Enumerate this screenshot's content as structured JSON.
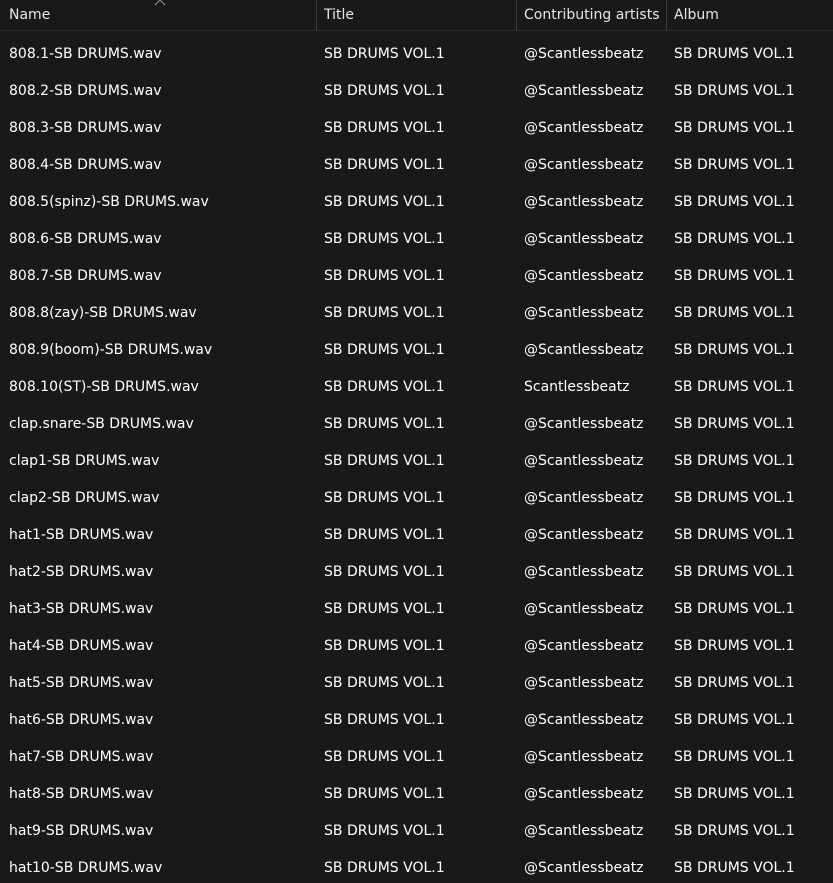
{
  "columns": {
    "name": "Name",
    "title": "Title",
    "artist": "Contributing artists",
    "album": "Album"
  },
  "sort": {
    "icon": "chevron-up-icon",
    "column": "Name"
  },
  "files": [
    {
      "name": "808.1-SB DRUMS.wav",
      "title": "SB DRUMS VOL.1",
      "artist": "@Scantlessbeatz",
      "album": "SB DRUMS VOL.1"
    },
    {
      "name": "808.2-SB DRUMS.wav",
      "title": "SB DRUMS VOL.1",
      "artist": "@Scantlessbeatz",
      "album": "SB DRUMS VOL.1"
    },
    {
      "name": "808.3-SB DRUMS.wav",
      "title": "SB DRUMS VOL.1",
      "artist": "@Scantlessbeatz",
      "album": "SB DRUMS VOL.1"
    },
    {
      "name": "808.4-SB DRUMS.wav",
      "title": "SB DRUMS VOL.1",
      "artist": "@Scantlessbeatz",
      "album": "SB DRUMS VOL.1"
    },
    {
      "name": "808.5(spinz)-SB DRUMS.wav",
      "title": "SB DRUMS VOL.1",
      "artist": "@Scantlessbeatz",
      "album": "SB DRUMS VOL.1"
    },
    {
      "name": "808.6-SB DRUMS.wav",
      "title": "SB DRUMS VOL.1",
      "artist": "@Scantlessbeatz",
      "album": "SB DRUMS VOL.1"
    },
    {
      "name": "808.7-SB DRUMS.wav",
      "title": "SB DRUMS VOL.1",
      "artist": "@Scantlessbeatz",
      "album": "SB DRUMS VOL.1"
    },
    {
      "name": "808.8(zay)-SB DRUMS.wav",
      "title": "SB DRUMS VOL.1",
      "artist": "@Scantlessbeatz",
      "album": "SB DRUMS VOL.1"
    },
    {
      "name": "808.9(boom)-SB DRUMS.wav",
      "title": "SB DRUMS VOL.1",
      "artist": "@Scantlessbeatz",
      "album": "SB DRUMS VOL.1"
    },
    {
      "name": "808.10(ST)-SB DRUMS.wav",
      "title": "SB DRUMS VOL.1",
      "artist": "Scantlessbeatz",
      "album": "SB DRUMS VOL.1"
    },
    {
      "name": "clap.snare-SB DRUMS.wav",
      "title": "SB DRUMS VOL.1",
      "artist": "@Scantlessbeatz",
      "album": "SB DRUMS VOL.1"
    },
    {
      "name": "clap1-SB DRUMS.wav",
      "title": "SB DRUMS VOL.1",
      "artist": "@Scantlessbeatz",
      "album": "SB DRUMS VOL.1"
    },
    {
      "name": "clap2-SB DRUMS.wav",
      "title": "SB DRUMS VOL.1",
      "artist": "@Scantlessbeatz",
      "album": "SB DRUMS VOL.1"
    },
    {
      "name": "hat1-SB DRUMS.wav",
      "title": "SB DRUMS VOL.1",
      "artist": "@Scantlessbeatz",
      "album": "SB DRUMS VOL.1"
    },
    {
      "name": "hat2-SB DRUMS.wav",
      "title": "SB DRUMS VOL.1",
      "artist": "@Scantlessbeatz",
      "album": "SB DRUMS VOL.1"
    },
    {
      "name": "hat3-SB DRUMS.wav",
      "title": "SB DRUMS VOL.1",
      "artist": "@Scantlessbeatz",
      "album": "SB DRUMS VOL.1"
    },
    {
      "name": "hat4-SB DRUMS.wav",
      "title": "SB DRUMS VOL.1",
      "artist": "@Scantlessbeatz",
      "album": "SB DRUMS VOL.1"
    },
    {
      "name": "hat5-SB DRUMS.wav",
      "title": "SB DRUMS VOL.1",
      "artist": "@Scantlessbeatz",
      "album": "SB DRUMS VOL.1"
    },
    {
      "name": "hat6-SB DRUMS.wav",
      "title": "SB DRUMS VOL.1",
      "artist": "@Scantlessbeatz",
      "album": "SB DRUMS VOL.1"
    },
    {
      "name": "hat7-SB DRUMS.wav",
      "title": "SB DRUMS VOL.1",
      "artist": "@Scantlessbeatz",
      "album": "SB DRUMS VOL.1"
    },
    {
      "name": "hat8-SB DRUMS.wav",
      "title": "SB DRUMS VOL.1",
      "artist": "@Scantlessbeatz",
      "album": "SB DRUMS VOL.1"
    },
    {
      "name": "hat9-SB DRUMS.wav",
      "title": "SB DRUMS VOL.1",
      "artist": "@Scantlessbeatz",
      "album": "SB DRUMS VOL.1"
    },
    {
      "name": "hat10-SB DRUMS.wav",
      "title": "SB DRUMS VOL.1",
      "artist": "@Scantlessbeatz",
      "album": "SB DRUMS VOL.1"
    }
  ]
}
